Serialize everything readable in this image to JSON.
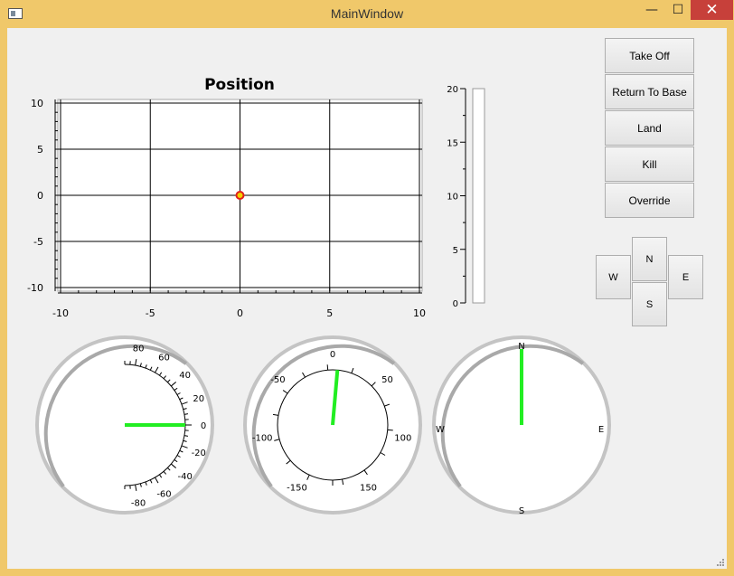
{
  "window": {
    "title": "MainWindow",
    "minimize": "—",
    "maximize": "☐",
    "close": "✕"
  },
  "buttons": {
    "take_off": "Take Off",
    "return_to_base": "Return To Base",
    "land": "Land",
    "kill": "Kill",
    "override": "Override"
  },
  "direction_pad": {
    "north": "N",
    "west": "W",
    "east": "E",
    "south": "S"
  },
  "chart_data": [
    {
      "type": "scatter",
      "title": "Position",
      "xlim": [
        -10,
        10
      ],
      "ylim": [
        -10,
        10
      ],
      "x_ticks": [
        "-10",
        "-5",
        "0",
        "5",
        "10"
      ],
      "y_ticks": [
        "10",
        "5",
        "0",
        "-5",
        "-10"
      ],
      "grid": true,
      "points": [
        {
          "x": 0,
          "y": 0
        }
      ],
      "marker_colors": {
        "fill": "#f5d000",
        "edge": "#e0201a"
      }
    },
    {
      "type": "bar",
      "orientation": "vertical-level",
      "ylim": [
        0,
        20
      ],
      "y_ticks": [
        "20",
        "15",
        "10",
        "5",
        "0"
      ],
      "value": 0
    }
  ],
  "dials": {
    "attitude": {
      "labels": [
        "80",
        "60",
        "40",
        "20",
        "0",
        "-20",
        "-40",
        "-60",
        "-80"
      ],
      "needle_value": 0,
      "needle_color": "#22ee22"
    },
    "heading_offset": {
      "labels": [
        "0",
        "50",
        "100",
        "150",
        "-150",
        "-100",
        "-50"
      ],
      "needle_value": 5,
      "needle_color": "#22ee22"
    },
    "compass": {
      "labels": [
        "N",
        "E",
        "S",
        "W"
      ],
      "needle_value": 0,
      "needle_color": "#22ee22"
    }
  }
}
